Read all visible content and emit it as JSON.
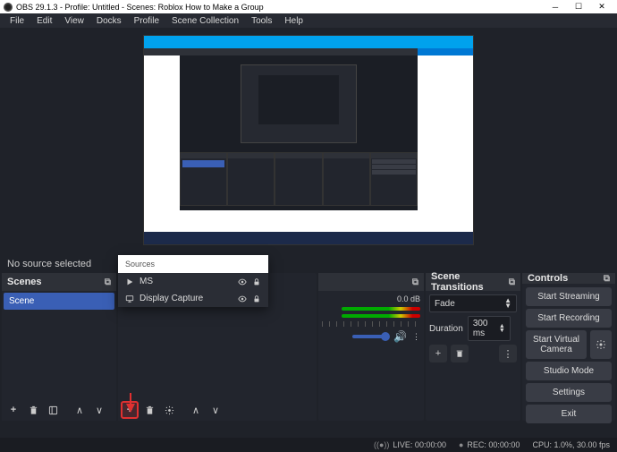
{
  "titlebar": {
    "title": "OBS 29.1.3 - Profile: Untitled - Scenes: Roblox How to Make a Group"
  },
  "menubar": {
    "items": [
      "File",
      "Edit",
      "View",
      "Docks",
      "Profile",
      "Scene Collection",
      "Tools",
      "Help"
    ]
  },
  "nosource_text": "No source selected",
  "sources_popup": {
    "header": "Sources",
    "items": [
      {
        "icon": "play-icon",
        "label": "MS"
      },
      {
        "icon": "monitor-icon",
        "label": "Display Capture"
      }
    ]
  },
  "scenes": {
    "title": "Scenes",
    "items": [
      "Scene"
    ]
  },
  "mixer": {
    "db_label": "0.0 dB",
    "ticks": [
      "-60",
      "-50",
      "-40",
      "-30",
      "-20",
      "-10",
      "0"
    ]
  },
  "transitions": {
    "title": "Scene Transitions",
    "selected": "Fade",
    "duration_label": "Duration",
    "duration_value": "300 ms"
  },
  "controls": {
    "title": "Controls",
    "buttons": {
      "stream": "Start Streaming",
      "record": "Start Recording",
      "vcam": "Start Virtual Camera",
      "studio": "Studio Mode",
      "settings": "Settings",
      "exit": "Exit"
    }
  },
  "statusbar": {
    "live_icon": "((●))",
    "live": "LIVE: 00:00:00",
    "rec_icon": "●",
    "rec": "REC: 00:00:00",
    "cpu": "CPU: 1.0%, 30.00 fps"
  }
}
